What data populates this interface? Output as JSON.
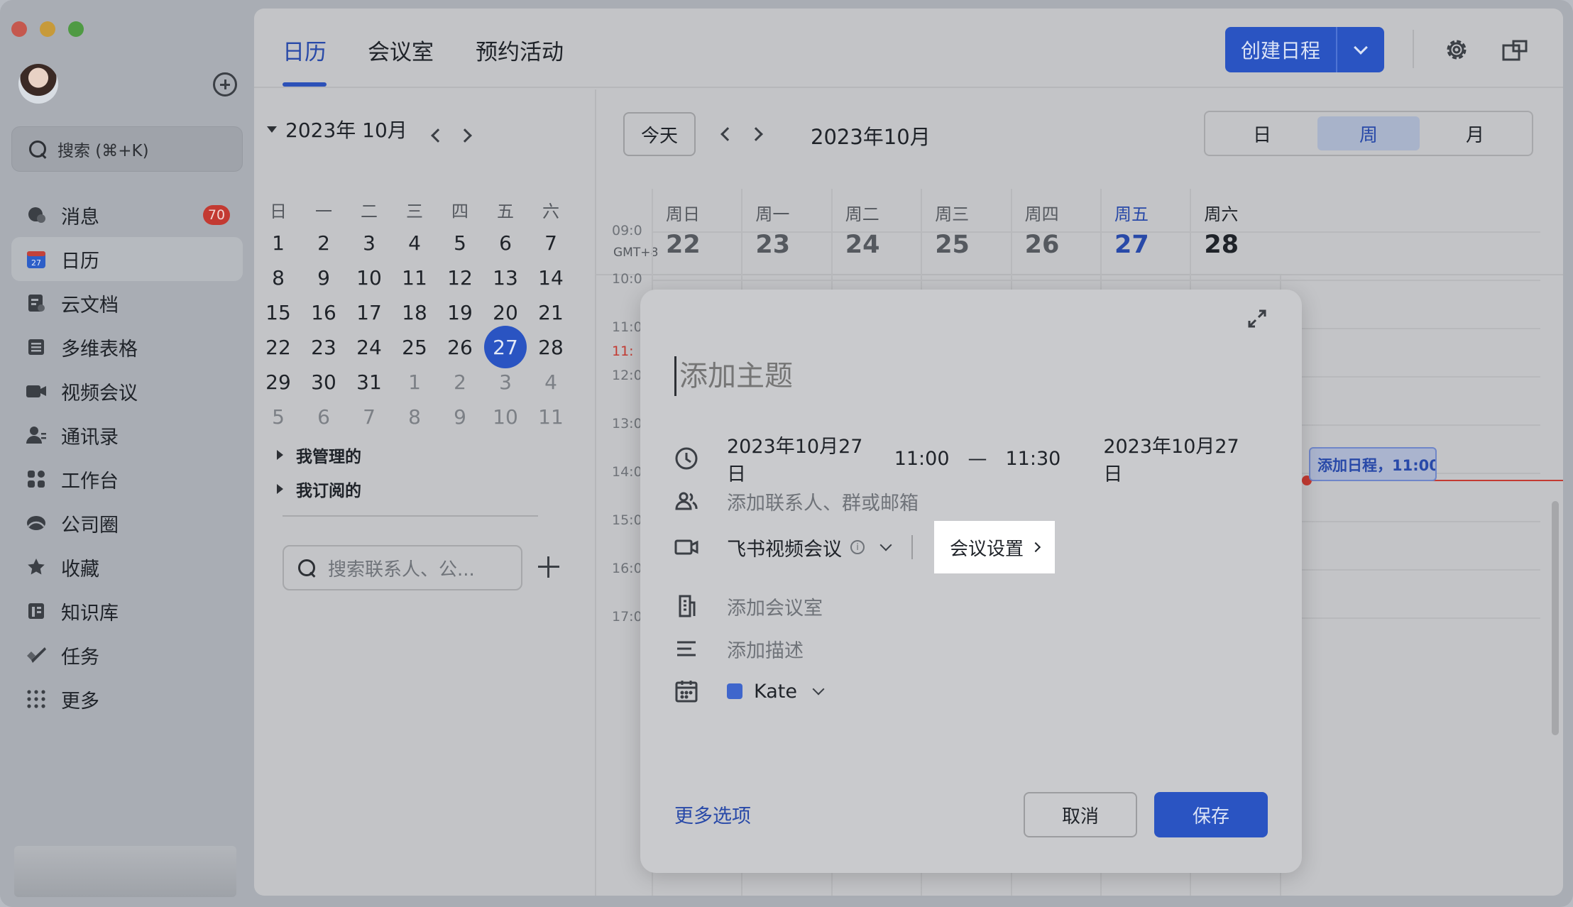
{
  "nav": {
    "search_placeholder": "搜索 (⌘+K)",
    "items": [
      {
        "label": "消息",
        "icon": "chat-bubble-icon",
        "badge": "70"
      },
      {
        "label": "日历",
        "icon": "calendar-icon",
        "active": true
      },
      {
        "label": "云文档",
        "icon": "docs-icon"
      },
      {
        "label": "多维表格",
        "icon": "table-icon"
      },
      {
        "label": "视频会议",
        "icon": "video-camera-icon"
      },
      {
        "label": "通讯录",
        "icon": "contacts-icon"
      },
      {
        "label": "工作台",
        "icon": "workspace-grid-icon"
      },
      {
        "label": "公司圈",
        "icon": "moments-icon"
      },
      {
        "label": "收藏",
        "icon": "star-icon"
      },
      {
        "label": "知识库",
        "icon": "knowledge-icon"
      },
      {
        "label": "任务",
        "icon": "check-icon"
      },
      {
        "label": "更多",
        "icon": "dots-grid-icon"
      }
    ]
  },
  "topbar": {
    "tabs": [
      "日历",
      "会议室",
      "预约活动"
    ],
    "active_tab": 0,
    "create_label": "创建日程"
  },
  "minical": {
    "month_label": "2023年 10月",
    "weekdays": [
      "日",
      "一",
      "二",
      "三",
      "四",
      "五",
      "六"
    ],
    "weeks": [
      [
        "1",
        "2",
        "3",
        "4",
        "5",
        "6",
        "7"
      ],
      [
        "8",
        "9",
        "10",
        "11",
        "12",
        "13",
        "14"
      ],
      [
        "15",
        "16",
        "17",
        "18",
        "19",
        "20",
        "21"
      ],
      [
        "22",
        "23",
        "24",
        "25",
        "26",
        "27",
        "28"
      ],
      [
        "29",
        "30",
        "31",
        "1",
        "2",
        "3",
        "4"
      ],
      [
        "5",
        "6",
        "7",
        "8",
        "9",
        "10",
        "11"
      ]
    ],
    "today": "27",
    "contact_search_placeholder": "搜索联系人、公...",
    "groups": [
      "我管理的",
      "我订阅的"
    ]
  },
  "week": {
    "today_label": "今天",
    "title": "2023年10月",
    "views": [
      "日",
      "周",
      "月"
    ],
    "active_view": 1,
    "timezone": "GMT+8",
    "days": [
      {
        "weekday": "周日",
        "date": "22"
      },
      {
        "weekday": "周一",
        "date": "23"
      },
      {
        "weekday": "周二",
        "date": "24"
      },
      {
        "weekday": "周三",
        "date": "25"
      },
      {
        "weekday": "周四",
        "date": "26"
      },
      {
        "weekday": "周五",
        "date": "27",
        "today": true
      },
      {
        "weekday": "周六",
        "date": "28"
      }
    ],
    "hours": [
      "09:0",
      "10:0",
      "11:0",
      "11:",
      "12:0",
      "13:0",
      "14:0",
      "15:0",
      "16:0",
      "17:0"
    ],
    "draft_event": "添加日程，11:00"
  },
  "modal": {
    "title_placeholder": "添加主题",
    "start_date": "2023年10月27日",
    "start_time": "11:00",
    "dash": "—",
    "end_time": "11:30",
    "end_date": "2023年10月27日",
    "attendees_placeholder": "添加联系人、群或邮箱",
    "video_label": "飞书视频会议",
    "meeting_settings": "会议设置",
    "room_placeholder": "添加会议室",
    "desc_placeholder": "添加描述",
    "calendar_owner": "Kate",
    "calendar_color": "#3f66cc",
    "more_options": "更多选项",
    "cancel": "取消",
    "save": "保存"
  }
}
